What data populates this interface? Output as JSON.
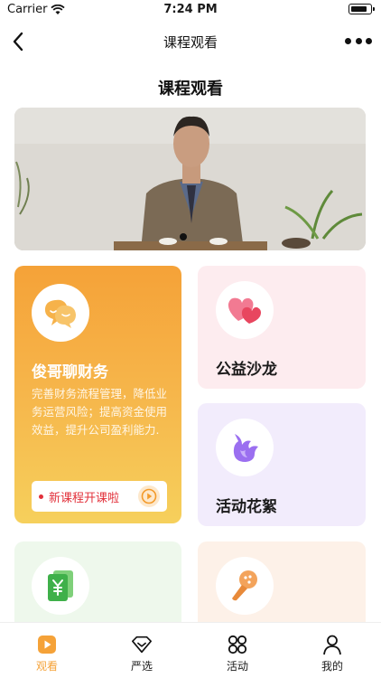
{
  "status_bar": {
    "carrier": "Carrier",
    "time": "7:24 PM"
  },
  "nav": {
    "title": "课程观看"
  },
  "page": {
    "heading": "课程观看"
  },
  "banner": {
    "image": "speaker-seated-photo",
    "indicator": "carousel-dot"
  },
  "cards": {
    "main": {
      "title": "俊哥聊财务",
      "description": "完善财务流程管理，降低业务运营风险；提高资金使用效益，提升公司盈利能力.",
      "cta_label": "新课程开课啦",
      "icon": "chat-bubbles-icon"
    },
    "salon": {
      "title": "公益沙龙",
      "icon": "hearts-icon"
    },
    "activity": {
      "title": "活动花絮",
      "icon": "flame-icon"
    },
    "finance": {
      "icon": "yuan-note-icon"
    },
    "mic": {
      "icon": "microphone-icon"
    }
  },
  "tabs": [
    {
      "label": "观看",
      "icon": "play-icon",
      "active": true
    },
    {
      "label": "严选",
      "icon": "diamond-icon",
      "active": false
    },
    {
      "label": "活动",
      "icon": "grid-icon",
      "active": false
    },
    {
      "label": "我的",
      "icon": "person-icon",
      "active": false
    }
  ],
  "colors": {
    "accent": "#f5a238",
    "cta_text": "#e2303a"
  }
}
